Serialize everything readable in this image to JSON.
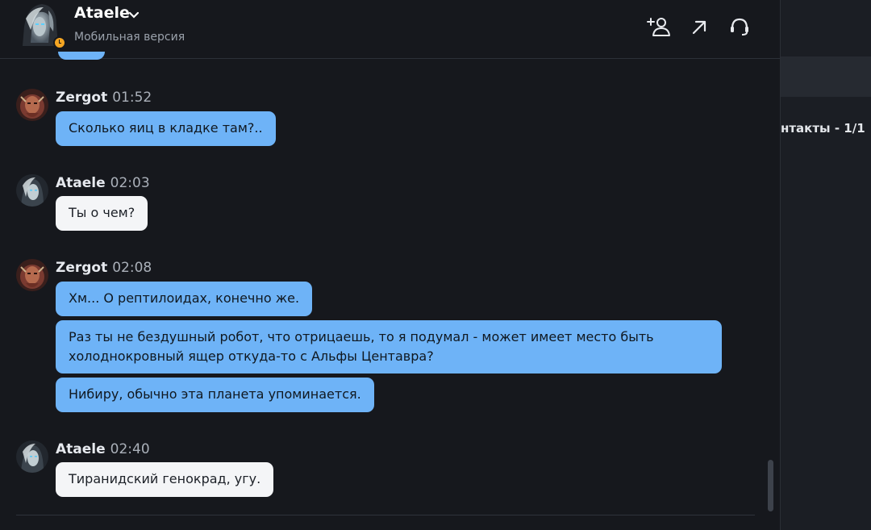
{
  "header": {
    "name": "Ataele",
    "subtitle": "Мобильная версия",
    "icons": [
      "add-contact-icon",
      "arrow-up-right-icon",
      "headset-icon"
    ]
  },
  "colors": {
    "background": "#16181d",
    "incoming_bubble": "#6eb3f7",
    "outgoing_bubble": "#f4f5f7",
    "status": "#f5a623"
  },
  "messages": [
    {
      "sender": "Zergot",
      "time": "01:52",
      "bubbles": [
        "Сколько яиц в кладке там?.."
      ]
    },
    {
      "sender": "Ataele",
      "time": "02:03",
      "bubbles": [
        "Ты о чем?"
      ]
    },
    {
      "sender": "Zergot",
      "time": "02:08",
      "bubbles": [
        "Хм... О рептилоидах, конечно же.",
        "Раз ты не бездушный робот, что отрицаешь, то я подумал - может имеет место быть холоднокровный ящер откуда-то  с Альфы Центавра?",
        "Нибиру, обычно эта планета упоминается."
      ]
    },
    {
      "sender": "Ataele",
      "time": "02:40",
      "bubbles": [
        "Тиранидский генокрад, угу."
      ]
    }
  ],
  "right_panel": {
    "contacts_label": "нтакты - 1/1"
  }
}
